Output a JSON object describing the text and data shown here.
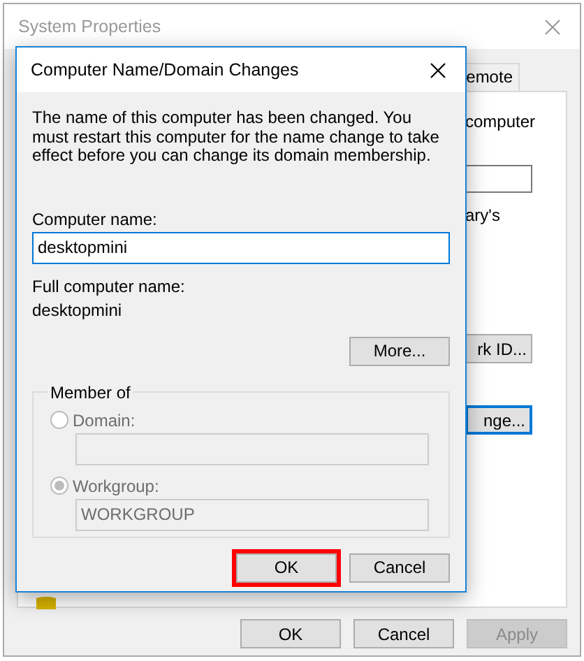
{
  "window": {
    "title": "System Properties",
    "tab": {
      "label": "emote",
      "selected": false
    },
    "panel": {
      "texts": [
        "computer",
        "ary's"
      ],
      "buttons": [
        "rk ID...",
        "nge..."
      ]
    },
    "buttons": [
      {
        "label": "OK",
        "disabled": false
      },
      {
        "label": "Cancel",
        "disabled": false
      },
      {
        "label": "Apply",
        "disabled": true
      }
    ]
  },
  "dialog": {
    "title": "Computer Name/Domain Changes",
    "message": "The name of this computer has been changed.  You must restart this computer for the name change to take effect before you can change its domain membership.",
    "computer_name": {
      "label": "Computer name:",
      "value": "desktopmini"
    },
    "full_name": {
      "label": "Full computer name:",
      "value": "desktopmini"
    },
    "more_button": "More...",
    "member_of": {
      "title": "Member of",
      "disabled": true,
      "options": [
        {
          "label": "Domain:",
          "selected": false
        },
        {
          "label": "Workgroup:",
          "selected": true,
          "value": "WORKGROUP"
        }
      ]
    },
    "buttons": [
      {
        "label": "OK",
        "highlighted": true
      },
      {
        "label": "Cancel",
        "highlighted": false
      }
    ]
  }
}
